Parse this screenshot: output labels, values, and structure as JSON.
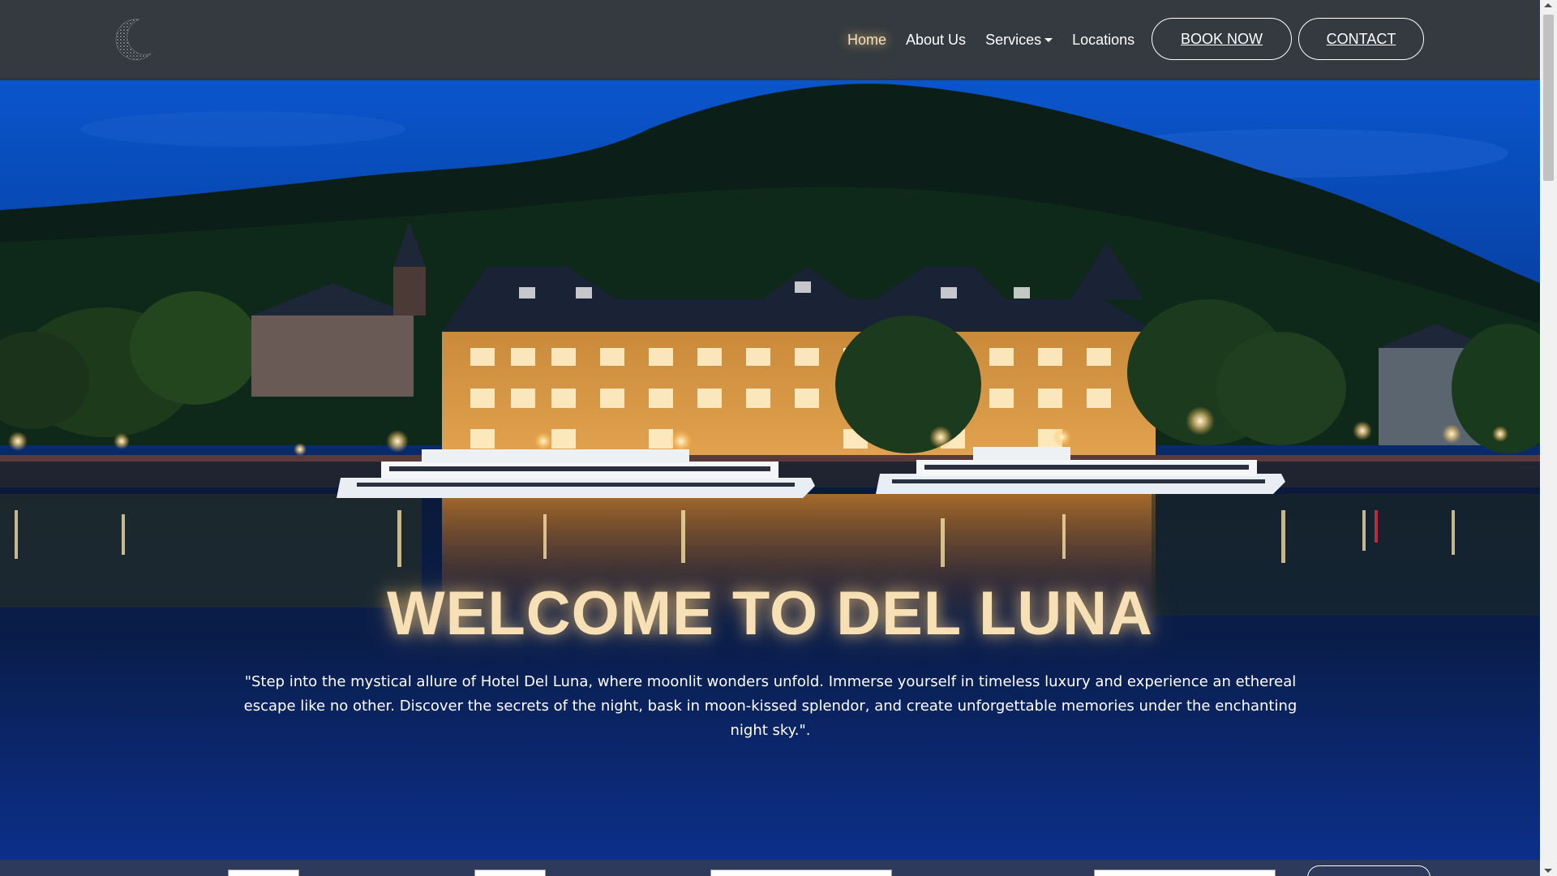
{
  "colors": {
    "navbar_bg": "#343a40",
    "accent_glow": "#f7e0b5",
    "hero_sky": "#0b4fc4",
    "bottom_bar": "#2e3a5c"
  },
  "header": {
    "logo_icon": "crescent-moon-logo",
    "nav": {
      "home": "Home",
      "about": "About Us",
      "services": "Services",
      "locations": "Locations"
    },
    "book_now": "BOOK NOW",
    "contact": "CONTACT"
  },
  "hero": {
    "title": "WELCOME TO DEL LUNA",
    "text": "\"Step into the mystical allure of Hotel Del Luna, where moonlit wonders unfold. Immerse yourself in timeless luxury and experience an ethereal escape like no other. Discover the secrets of the night, bask in moon-kissed splendor, and create unforgettable memories under the enchanting night sky.\"."
  }
}
